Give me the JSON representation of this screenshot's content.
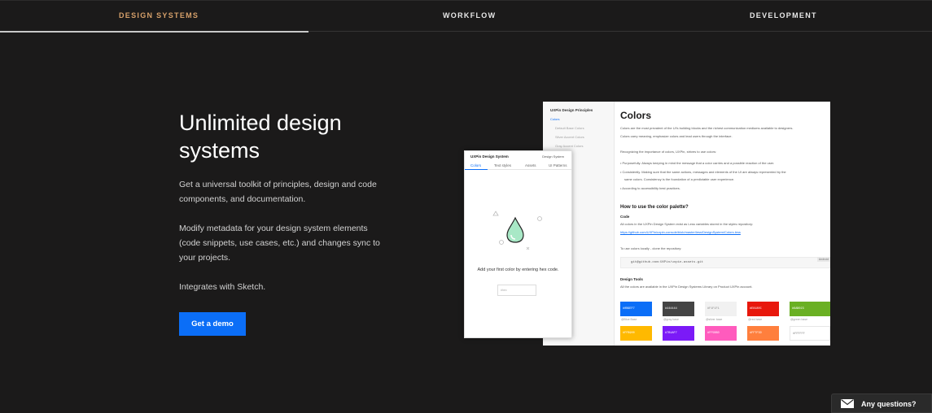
{
  "tabs": [
    {
      "label": "DESIGN SYSTEMS",
      "active": true
    },
    {
      "label": "WORKFLOW",
      "active": false
    },
    {
      "label": "DEVELOPMENT",
      "active": false
    }
  ],
  "hero": {
    "title": "Unlimited design systems",
    "p1": "Get a universal toolkit of principles, design and code components, and documentation.",
    "p2": "Modify metadata for your design system elements (code snippets, use cases, etc.) and changes sync to your projects.",
    "p3": "Integrates with Sketch.",
    "cta": "Get a demo"
  },
  "doc": {
    "sidebar_title": "UXPin Design Principles",
    "sidebar_items": [
      "Colors",
      "Default Base Colors",
      "Silver Accent Colors",
      "Gray Accent Colors",
      "Colors",
      "Colors",
      "Colors",
      "Colors",
      "Colors",
      "Colors",
      "Colors",
      "Colors"
    ],
    "title": "Colors",
    "intro1": "Colors are the most prevalent of the UI's building blocks and the richest communication mediums available to designers.",
    "intro2": "Colors carry meaning, emphasize colors and lead users through the interface.",
    "rec": "Recognizing the importance of colors, UXPin, strives to use colors:",
    "b1": "• Purposefully. Always keeping in mind the message that a color carries and a possible reaction of the user.",
    "b2": "• Consistently. Making sure that the same actions, messages and elements of the UI are always represented by the",
    "b2b": "same colors. Consistency is the foundation of a predictable user experience.",
    "b3": "• According to accessibility best practices.",
    "h2": "How to use the color palette?",
    "h3_code": "Code",
    "code_txt": "All colors in the UXPin Design System exist as  Less variables  stored in the styles repository:",
    "link": "https://github.com/UXPin/uxpin-console/blob/master/less/DesignSystem/Colors.less",
    "clone": "To use colors locally - clone the repository:",
    "code": "git@github.com:UXPin/uxpin-assets.git",
    "copy": "Android",
    "h3_tools": "Design Tools",
    "tools_txt": "All the colors are available in the UXPin Design Systems Library on  Product UXPin  account.",
    "swatches": [
      {
        "hex": "#0b6ef7",
        "label": "#0B6EF7",
        "name": "@Blue Base"
      },
      {
        "hex": "#444444",
        "label": "#444444",
        "name": "@gray base"
      },
      {
        "hex": "#f1f1f1",
        "label": "#F1F1F1",
        "name": "@silver base"
      },
      {
        "hex": "#e8180c",
        "label": "#E8180C",
        "name": "@red base"
      },
      {
        "hex": "#6ab023",
        "label": "#6AB023",
        "name": "@green base"
      },
      {
        "hex": "#ffb900",
        "label": "#FFB900",
        "name": ""
      },
      {
        "hex": "#7b1af7",
        "label": "#7B1AF7",
        "name": ""
      },
      {
        "hex": "#ff5bbd",
        "label": "#FF5BBD",
        "name": ""
      },
      {
        "hex": "#ff7f3d",
        "label": "#FF7F3D",
        "name": ""
      },
      {
        "hex": "#ffffff",
        "label": "#FFFFFF",
        "name": ""
      }
    ]
  },
  "app": {
    "title": "UXPin Design System",
    "right": "Design System",
    "tabs": [
      "Colors",
      "Text styles",
      "Assets",
      "UI Patterns"
    ],
    "empty": "Add your first color by entering hex code.",
    "placeholder": "#hex"
  },
  "chat": {
    "label": "Any questions?"
  },
  "colors": {
    "background": "#1b1a1a",
    "accent": "#d6a06a",
    "primary": "#0b6ef7"
  },
  "icons": [
    "mail-icon",
    "droplet-icon"
  ]
}
